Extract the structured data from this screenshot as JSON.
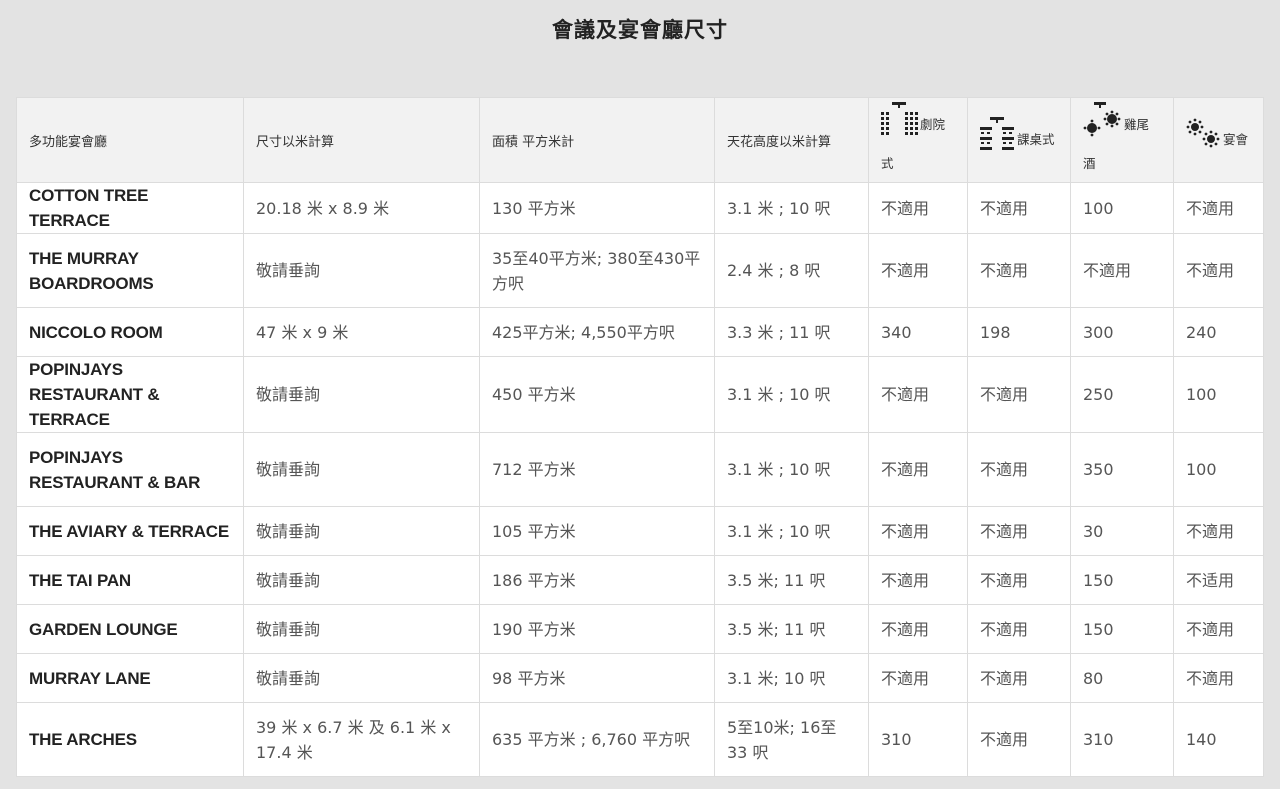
{
  "page": {
    "title": "會議及宴會廳尺寸"
  },
  "table": {
    "headers": {
      "venue": "多功能宴會廳",
      "dimensions": "尺寸以米計算",
      "area": "面積 平方米計",
      "height": "天花高度以米計算",
      "theatre": "劇院式",
      "classroom": "課桌式",
      "cocktail": "雞尾酒",
      "banquet": "宴會"
    },
    "icons": {
      "theatre": "theatre-seating-icon",
      "classroom": "classroom-seating-icon",
      "cocktail": "cocktail-seating-icon",
      "banquet": "banquet-seating-icon"
    },
    "rows": [
      {
        "venue": "COTTON TREE TERRACE",
        "dimensions": "20.18 米 x 8.9 米",
        "area": "130 平方米",
        "height": "3.1 米 ; 10 呎",
        "theatre": "不適用",
        "classroom": "不適用",
        "cocktail": "100",
        "banquet": "不適用"
      },
      {
        "venue": "THE MURRAY BOARDROOMS",
        "dimensions": "敬請垂詢",
        "area": "35至40平方米; 380至430平方呎",
        "height": "2.4 米 ; 8 呎",
        "theatre": "不適用",
        "classroom": "不適用",
        "cocktail": "不適用",
        "banquet": "不適用"
      },
      {
        "venue": "NICCOLO ROOM",
        "dimensions": "47 米 x 9 米",
        "area": "425平方米; 4,550平方呎",
        "height": "3.3 米 ; 11 呎",
        "theatre": "340",
        "classroom": "198",
        "cocktail": "300",
        "banquet": "240"
      },
      {
        "venue": "POPINJAYS RESTAURANT & TERRACE",
        "dimensions": "敬請垂詢",
        "area": "450 平方米",
        "height": "3.1 米 ; 10 呎",
        "theatre": "不適用",
        "classroom": "不適用",
        "cocktail": "250",
        "banquet": "100"
      },
      {
        "venue": "POPINJAYS RESTAURANT & BAR",
        "dimensions": "敬請垂詢",
        "area": "712 平方米",
        "height": "3.1 米 ; 10 呎",
        "theatre": "不適用",
        "classroom": "不適用",
        "cocktail": "350",
        "banquet": "100"
      },
      {
        "venue": "THE AVIARY & TERRACE",
        "dimensions": "敬請垂詢",
        "area": "105 平方米",
        "height": "3.1 米 ; 10 呎",
        "theatre": "不適用",
        "classroom": "不適用",
        "cocktail": "30",
        "banquet": "不適用"
      },
      {
        "venue": "THE TAI PAN",
        "dimensions": "敬請垂詢",
        "area": "186 平方米",
        "height": "3.5 米; 11 呎",
        "theatre": "不適用",
        "classroom": "不適用",
        "cocktail": "150",
        "banquet": "不适用"
      },
      {
        "venue": "GARDEN LOUNGE",
        "dimensions": "敬請垂詢",
        "area": "190 平方米",
        "height": "3.5 米; 11 呎",
        "theatre": "不適用",
        "classroom": "不適用",
        "cocktail": "150",
        "banquet": "不適用"
      },
      {
        "venue": "MURRAY LANE",
        "dimensions": "敬請垂詢",
        "area": "98 平方米",
        "height": "3.1 米; 10 呎",
        "theatre": "不適用",
        "classroom": "不適用",
        "cocktail": "80",
        "banquet": "不適用"
      },
      {
        "venue": "THE ARCHES",
        "dimensions": "39 米 x 6.7 米 及 6.1 米 x 17.4 米",
        "area": "635 平方米 ; 6,760 平方呎",
        "height": "5至10米; 16至33 呎",
        "theatre": "310",
        "classroom": "不適用",
        "cocktail": "310",
        "banquet": "140"
      }
    ]
  }
}
